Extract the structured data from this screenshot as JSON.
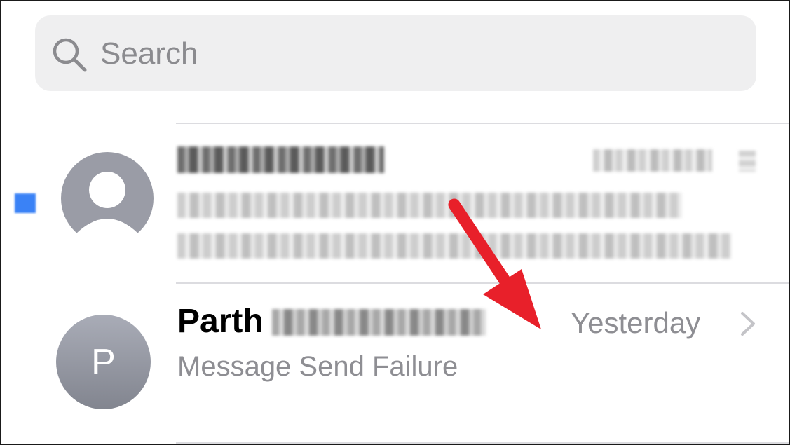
{
  "search": {
    "placeholder": "Search",
    "icon": "search-icon"
  },
  "conversations": [
    {
      "sender": "AX-CANTBL",
      "unread": true,
      "redacted": true,
      "avatar": "person-icon"
    },
    {
      "sender_first_name": "Parth",
      "avatar_initial": "P",
      "timestamp": "Yesterday",
      "preview": "Message Send Failure",
      "unread": false
    }
  ],
  "annotation": {
    "type": "arrow",
    "color": "#e8202a"
  },
  "colors": {
    "unread_dot": "#3a82f6",
    "secondary_text": "#8e8e93",
    "search_bg": "#efeff0",
    "divider": "#dcdce0"
  }
}
